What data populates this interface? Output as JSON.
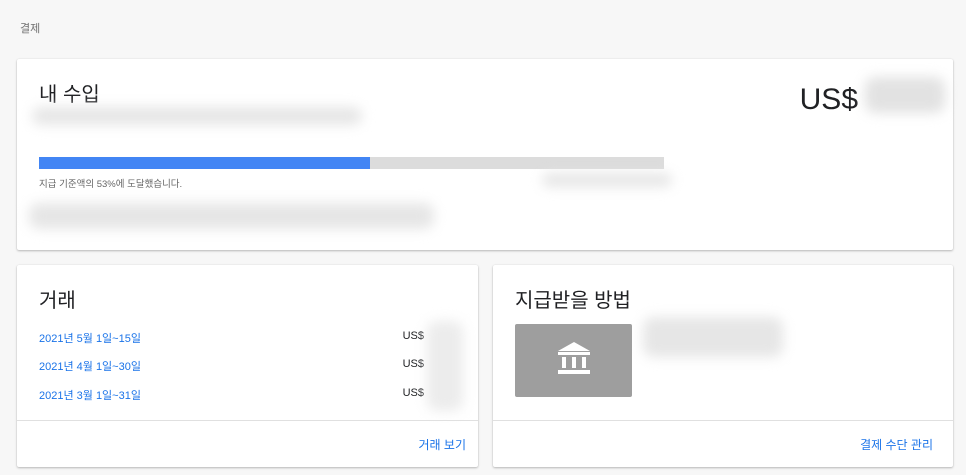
{
  "page": {
    "title": "결제"
  },
  "earnings": {
    "title": "내 수입",
    "amount_prefix": "US$",
    "progress_percent": 53,
    "progress_label": "지급 기준액의 53%에 도달했습니다."
  },
  "transactions": {
    "title": "거래",
    "rows": [
      {
        "date": "2021년 5월 1일~15일",
        "amount": "US$"
      },
      {
        "date": "2021년 4월 1일~30일",
        "amount": "US$"
      },
      {
        "date": "2021년 3월 1일~31일",
        "amount": "US$"
      }
    ],
    "view_link": "거래 보기"
  },
  "payment": {
    "title": "지급받을 방법",
    "icon": "bank-icon",
    "manage_link": "결제 수단 관리"
  },
  "colors": {
    "accent": "#1a73e8",
    "progress": "#4285f4",
    "track": "#dcdcdc",
    "bank_tile": "#9e9e9e"
  }
}
